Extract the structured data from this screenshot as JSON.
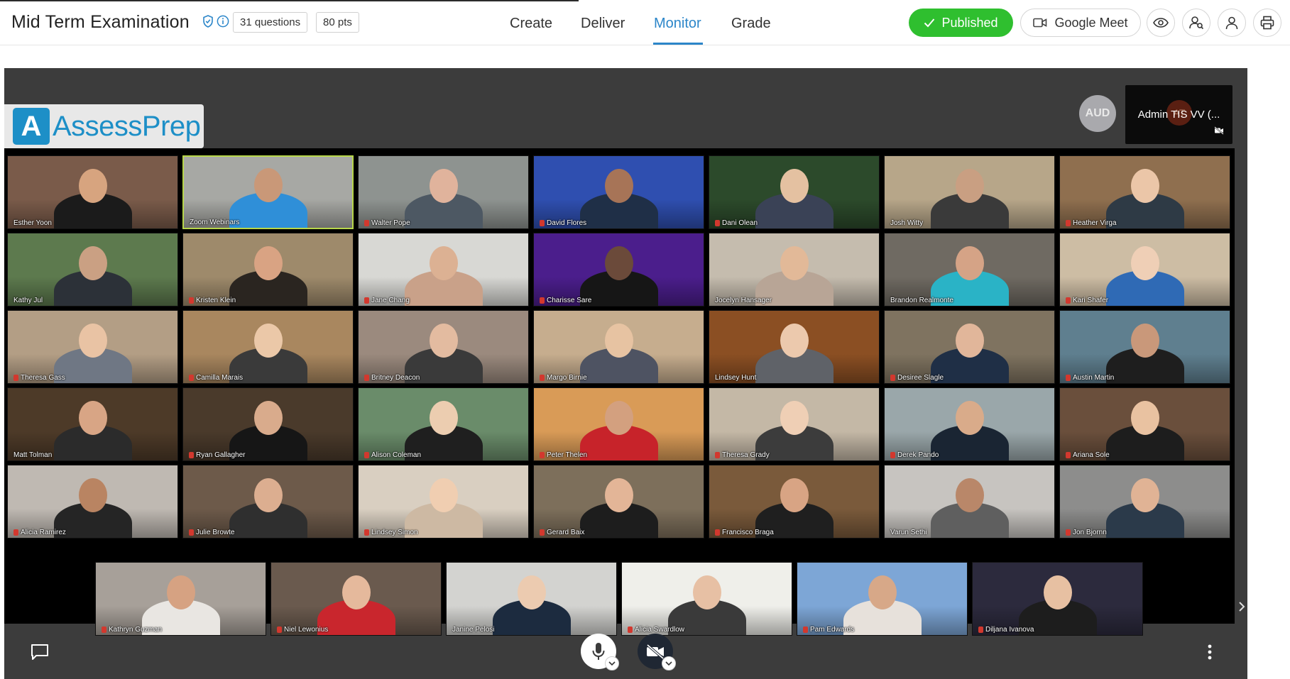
{
  "header": {
    "title": "Mid Term Examination",
    "questions_label": "31 questions",
    "points_label": "80 pts",
    "tabs": [
      {
        "label": "Create",
        "active": false
      },
      {
        "label": "Deliver",
        "active": false
      },
      {
        "label": "Monitor",
        "active": true
      },
      {
        "label": "Grade",
        "active": false
      }
    ],
    "published_label": "Published",
    "meet_label": "Google Meet",
    "accent_color": "#2c86c9",
    "published_color": "#2fbf2f"
  },
  "meeting": {
    "logo_letter": "A",
    "logo_text": "AssessPrep",
    "aud_avatar": "AUD",
    "self_view": {
      "initials": "AT",
      "name": "Admin TIS VV (..."
    },
    "participants": [
      {
        "name": "Esther Yoon",
        "muted": false,
        "bg": "#7a5b4a",
        "skin": "#d7a47f",
        "shirt": "#1b1b1b"
      },
      {
        "name": "Zoom Webinars",
        "muted": false,
        "bg": "#a7a8a4",
        "skin": "#c99878",
        "shirt": "#2f8fd8",
        "speaking": true
      },
      {
        "name": "Walter Pope",
        "muted": true,
        "bg": "#8e9390",
        "skin": "#e0b39c",
        "shirt": "#4d5863"
      },
      {
        "name": "David Flores",
        "muted": true,
        "bg": "#2f4fb0",
        "skin": "#a77457",
        "shirt": "#1f2f47"
      },
      {
        "name": "Dani Olean",
        "muted": true,
        "bg": "#2c4a2b",
        "skin": "#e4c1a1",
        "shirt": "#3a4256"
      },
      {
        "name": "Josh Witty",
        "muted": false,
        "bg": "#b7a689",
        "skin": "#c99f82",
        "shirt": "#3a3a3a"
      },
      {
        "name": "Heather Virga",
        "muted": true,
        "bg": "#8f6f4f",
        "skin": "#ebc6a8",
        "shirt": "#2e3a45"
      },
      {
        "name": "Kathy Jul",
        "muted": false,
        "bg": "#5d7a4e",
        "skin": "#caa083",
        "shirt": "#2c3138"
      },
      {
        "name": "Kristen Klein",
        "muted": true,
        "bg": "#9e8a6b",
        "skin": "#d9a383",
        "shirt": "#2a2520"
      },
      {
        "name": "Jane Chang",
        "muted": true,
        "bg": "#d8d8d4",
        "skin": "#dcb193",
        "shirt": "#c9a189"
      },
      {
        "name": "Charisse Sare",
        "muted": true,
        "bg": "#4b1e8c",
        "skin": "#6b4a3a",
        "shirt": "#161616"
      },
      {
        "name": "Jocelyn Hansager",
        "muted": false,
        "bg": "#c5bcae",
        "skin": "#e2b998",
        "shirt": "#b8a596"
      },
      {
        "name": "Brandon Realmonte",
        "muted": false,
        "bg": "#6f6a62",
        "skin": "#d5a386",
        "shirt": "#2ab3c6"
      },
      {
        "name": "Kari Shafer",
        "muted": true,
        "bg": "#cdbda4",
        "skin": "#efcfb6",
        "shirt": "#2f6ab5"
      },
      {
        "name": "Theresa Gass",
        "muted": true,
        "bg": "#b39e85",
        "skin": "#e9c3a4",
        "shirt": "#6f7784"
      },
      {
        "name": "Camilla Marais",
        "muted": true,
        "bg": "#a9875f",
        "skin": "#ebc8a8",
        "shirt": "#3a3a3a"
      },
      {
        "name": "Britney Deacon",
        "muted": true,
        "bg": "#9b8a7e",
        "skin": "#e3bba0",
        "shirt": "#3a3a3a"
      },
      {
        "name": "Margo Birnie",
        "muted": true,
        "bg": "#c6ad8e",
        "skin": "#e7c3a2",
        "shirt": "#4e5362"
      },
      {
        "name": "Lindsey Hunt",
        "muted": false,
        "bg": "#8b4f23",
        "skin": "#ecc9ad",
        "shirt": "#5f6268"
      },
      {
        "name": "Desiree Slagle",
        "muted": true,
        "bg": "#7f7360",
        "skin": "#e1b69a",
        "shirt": "#1f2f46"
      },
      {
        "name": "Austin Martin",
        "muted": true,
        "bg": "#5f7f8f",
        "skin": "#c9987a",
        "shirt": "#1e1e1e"
      },
      {
        "name": "Matt Tolman",
        "muted": false,
        "bg": "#4d3a28",
        "skin": "#d8a585",
        "shirt": "#2b2b2b"
      },
      {
        "name": "Ryan Gallagher",
        "muted": true,
        "bg": "#4a3a2b",
        "skin": "#d9ab8c",
        "shirt": "#161616"
      },
      {
        "name": "Alison Coleman",
        "muted": true,
        "bg": "#6a8c6a",
        "skin": "#eccdb0",
        "shirt": "#1f1f1f"
      },
      {
        "name": "Peter Thelen",
        "muted": true,
        "bg": "#d99b57",
        "skin": "#d3a07f",
        "shirt": "#c7232a"
      },
      {
        "name": "Theresa Grady",
        "muted": true,
        "bg": "#c4b8a6",
        "skin": "#efcfb5",
        "shirt": "#3c3c3c"
      },
      {
        "name": "Derek Pando",
        "muted": true,
        "bg": "#9aa7aa",
        "skin": "#d9ab8a",
        "shirt": "#1a2533"
      },
      {
        "name": "Ariana Sole",
        "muted": true,
        "bg": "#6a4f3c",
        "skin": "#e9c2a1",
        "shirt": "#1d1d1d"
      },
      {
        "name": "Alicia Ramirez",
        "muted": true,
        "bg": "#bfb9b2",
        "skin": "#b98462",
        "shirt": "#252525"
      },
      {
        "name": "Julie Browte",
        "muted": true,
        "bg": "#6d5a4a",
        "skin": "#dcae90",
        "shirt": "#2f2f2f"
      },
      {
        "name": "Lindsey Simon",
        "muted": true,
        "bg": "#d9cfc1",
        "skin": "#f0ceb1",
        "shirt": "#cdb9a3"
      },
      {
        "name": "Gerard Baix",
        "muted": true,
        "bg": "#7d6f5b",
        "skin": "#e3b597",
        "shirt": "#1d1d1d"
      },
      {
        "name": "Francisco Braga",
        "muted": true,
        "bg": "#7a5a3b",
        "skin": "#d8a484",
        "shirt": "#1f1f1f"
      },
      {
        "name": "Varun Sethi",
        "muted": false,
        "bg": "#c7c4c0",
        "skin": "#b98769",
        "shirt": "#5f5f5f"
      },
      {
        "name": "Jon Bjornn",
        "muted": true,
        "bg": "#8d8d8c",
        "skin": "#e0b395",
        "shirt": "#2b3a4a"
      }
    ],
    "last_row": [
      {
        "name": "Kathryn Guzman",
        "muted": true,
        "bg": "#a7a099",
        "skin": "#d6a282",
        "shirt": "#e9e6e2"
      },
      {
        "name": "Niel Lewonius",
        "muted": true,
        "bg": "#6a5a4e",
        "skin": "#e5b99c",
        "shirt": "#c9262d"
      },
      {
        "name": "Janine Pelosi",
        "muted": false,
        "bg": "#d3d3d0",
        "skin": "#eccbb0",
        "shirt": "#1c2b3f"
      },
      {
        "name": "Alicia Swardlow",
        "muted": true,
        "bg": "#efefea",
        "skin": "#e7c0a4",
        "shirt": "#3a3a3a"
      },
      {
        "name": "Pam Edwards",
        "muted": true,
        "bg": "#7da6d6",
        "skin": "#d7a888",
        "shirt": "#e7e1db"
      },
      {
        "name": "Diljana Ivanova",
        "muted": true,
        "bg": "#2c2a3d",
        "skin": "#e7c0a2",
        "shirt": "#1d1d1d"
      }
    ]
  },
  "icons": {
    "shield": "shield-icon",
    "info": "info-icon",
    "eye": "eye-icon",
    "monitor_users": "monitor-users-icon",
    "user": "user-icon",
    "print": "print-icon",
    "chat": "chat-icon",
    "mic": "microphone-icon",
    "camera_off": "camera-off-icon",
    "more": "more-vertical-icon"
  }
}
